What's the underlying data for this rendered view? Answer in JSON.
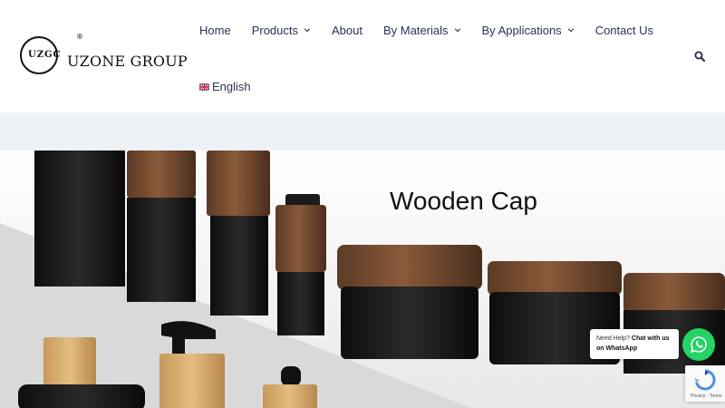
{
  "brand": {
    "name": "UZONE GROUP",
    "mark_letters": "UZGC",
    "registered": "®"
  },
  "nav": {
    "items": [
      {
        "label": "Home",
        "has_dropdown": false
      },
      {
        "label": "Products",
        "has_dropdown": true
      },
      {
        "label": "About",
        "has_dropdown": false
      },
      {
        "label": "By Materials",
        "has_dropdown": true
      },
      {
        "label": "By Applications",
        "has_dropdown": true
      },
      {
        "label": "Contact Us",
        "has_dropdown": false
      }
    ],
    "language": "English",
    "search_icon": "search-icon"
  },
  "hero": {
    "title": "Wooden Cap"
  },
  "whatsapp": {
    "line1": "Need Help?",
    "line1_bold": "Chat with us",
    "line2_bold": "on WhatsApp"
  },
  "recaptcha": {
    "links": "Privacy - Terms"
  },
  "colors": {
    "nav_text": "#2a3552",
    "band": "#eef2f6",
    "whatsapp": "#25d366"
  }
}
